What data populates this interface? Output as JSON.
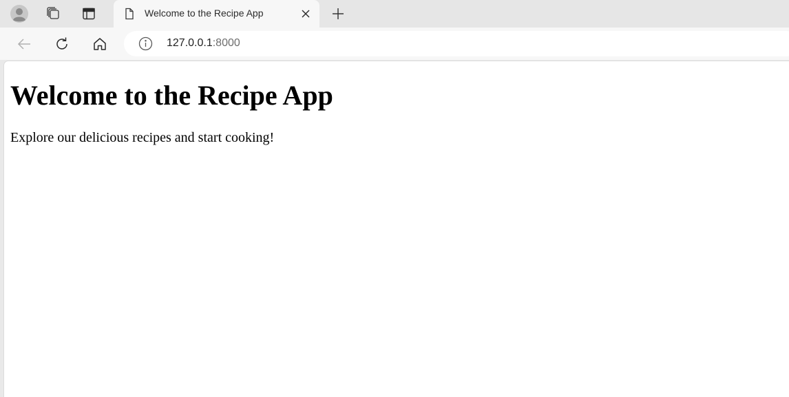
{
  "tab": {
    "title": "Welcome to the Recipe App",
    "icon": "page-icon"
  },
  "address_bar": {
    "url_host": "127.0.0.1",
    "url_port": ":8000",
    "info_icon": "info-icon"
  },
  "toolbar": {
    "icons": [
      "back-arrow-icon",
      "refresh-icon",
      "home-icon"
    ]
  },
  "tabstrip": {
    "icons": [
      "profile-avatar-icon",
      "workspaces-icon",
      "vertical-tabs-icon",
      "close-icon",
      "plus-icon"
    ]
  },
  "page": {
    "heading": "Welcome to the Recipe App",
    "text": "Explore our delicious recipes and start cooking!"
  },
  "colors": {
    "chrome_background": "#e6e6e6",
    "active_tab": "#f7f7f7",
    "page_background": "#ffffff",
    "text": "#000000"
  }
}
